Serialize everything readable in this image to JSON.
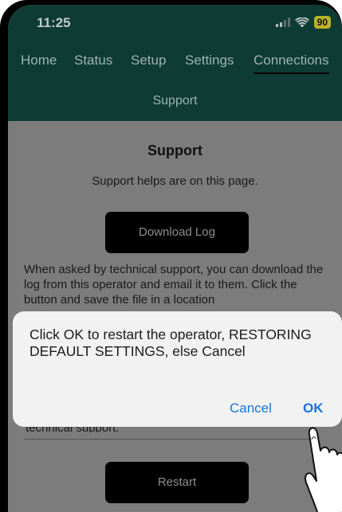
{
  "status_bar": {
    "time": "11:25",
    "battery": "90",
    "battery_color": "#b9b22a"
  },
  "nav": {
    "items": [
      {
        "label": "Home"
      },
      {
        "label": "Status"
      },
      {
        "label": "Setup"
      },
      {
        "label": "Settings"
      },
      {
        "label": "Connections",
        "active": true
      }
    ],
    "sub_item": "Support"
  },
  "page": {
    "title": "Support",
    "subtitle": "Support helps are on this page.",
    "download_button": "Download Log",
    "paragraph": "When asked by technical support, you can download the log from this operator and email it to them. Click the button and save the file in a location",
    "paragraph_tail": "technical support.",
    "restart_button": "Restart"
  },
  "dialog": {
    "message": "Click OK to restart the operator, RESTORING DEFAULT SETTINGS, else Cancel",
    "cancel_label": "Cancel",
    "ok_label": "OK"
  },
  "colors": {
    "header_bg": "#0e3c35",
    "link_blue": "#1a73d9",
    "overlay_gray": "#7c7c7c"
  },
  "icons": [
    "signal-icon",
    "wifi-icon",
    "battery-icon",
    "pointing-hand-icon"
  ]
}
